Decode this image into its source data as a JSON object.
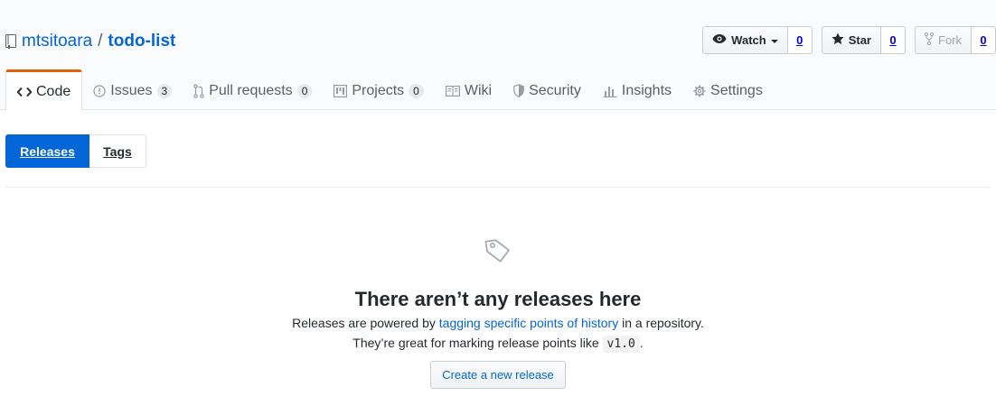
{
  "repo": {
    "owner": "mtsitoara",
    "separator": "/",
    "name": "todo-list"
  },
  "actions": {
    "watch": {
      "label": "Watch",
      "count": "0"
    },
    "star": {
      "label": "Star",
      "count": "0"
    },
    "fork": {
      "label": "Fork",
      "count": "0"
    }
  },
  "tabs": [
    {
      "label": "Code"
    },
    {
      "label": "Issues",
      "counter": "3"
    },
    {
      "label": "Pull requests",
      "counter": "0"
    },
    {
      "label": "Projects",
      "counter": "0"
    },
    {
      "label": "Wiki"
    },
    {
      "label": "Security"
    },
    {
      "label": "Insights"
    },
    {
      "label": "Settings"
    }
  ],
  "subnav": {
    "releases": "Releases",
    "tags": "Tags"
  },
  "blankslate": {
    "heading": "There aren’t any releases here",
    "line1_before": "Releases are powered by ",
    "line1_link": "tagging specific points of history",
    "line1_after": " in a repository.",
    "line2_before": "They’re great for marking release points like ",
    "line2_code": "v1.0",
    "line2_after": ".",
    "button": "Create a new release"
  },
  "colors": {
    "link": "#0366d6",
    "selected_tab_border": "#e36209",
    "active_subnav": "#0366d6"
  }
}
